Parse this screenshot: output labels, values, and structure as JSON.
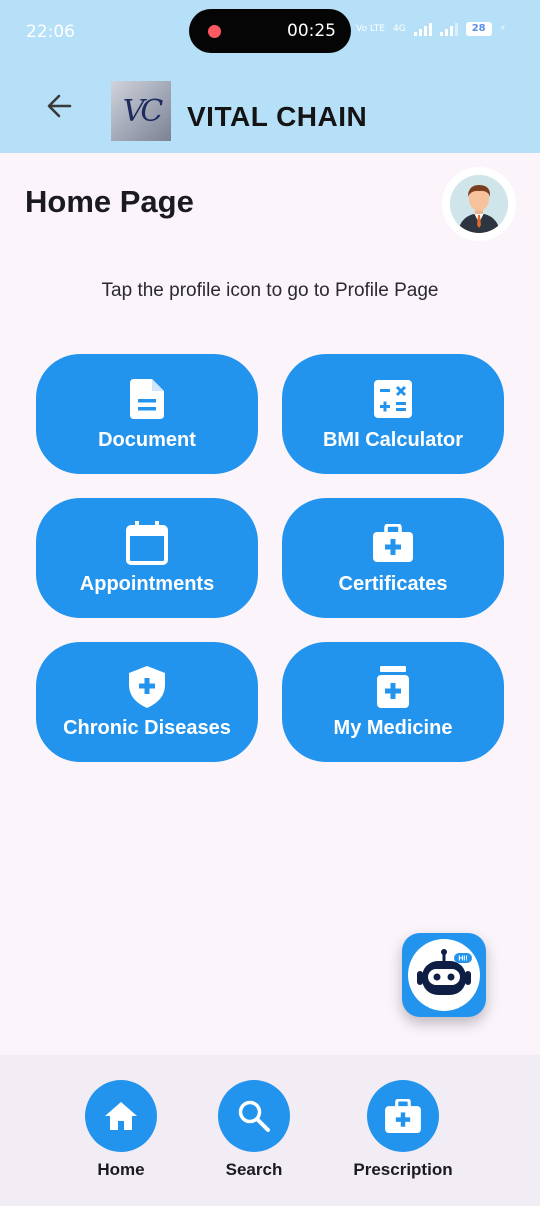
{
  "status_bar": {
    "time": "22:06",
    "recording_time": "00:25",
    "network_label": "Vo LTE",
    "network_type": "4G",
    "battery_level": "28"
  },
  "app_bar": {
    "logo_text": "VC",
    "title": "VITAL CHAIN"
  },
  "page": {
    "title": "Home Page",
    "hint": "Tap the profile icon to go to Profile Page"
  },
  "tiles": [
    {
      "label": "Document",
      "icon": "document-icon"
    },
    {
      "label": "BMI Calculator",
      "icon": "calculator-icon"
    },
    {
      "label": "Appointments",
      "icon": "calendar-icon"
    },
    {
      "label": "Certificates",
      "icon": "medical-kit-icon"
    },
    {
      "label": "Chronic Diseases",
      "icon": "shield-plus-icon"
    },
    {
      "label": "My Medicine",
      "icon": "medicine-bottle-icon"
    }
  ],
  "chatbot": {
    "bubble_text": "HI!"
  },
  "bottom_nav": [
    {
      "label": "Home",
      "icon": "home-icon"
    },
    {
      "label": "Search",
      "icon": "search-icon"
    },
    {
      "label": "Prescription",
      "icon": "medical-kit-icon"
    }
  ],
  "colors": {
    "primary": "#2294ee",
    "app_bar": "#b5e0f8",
    "background": "#fbf4fb",
    "bottom_nav": "#f2ecf5"
  }
}
